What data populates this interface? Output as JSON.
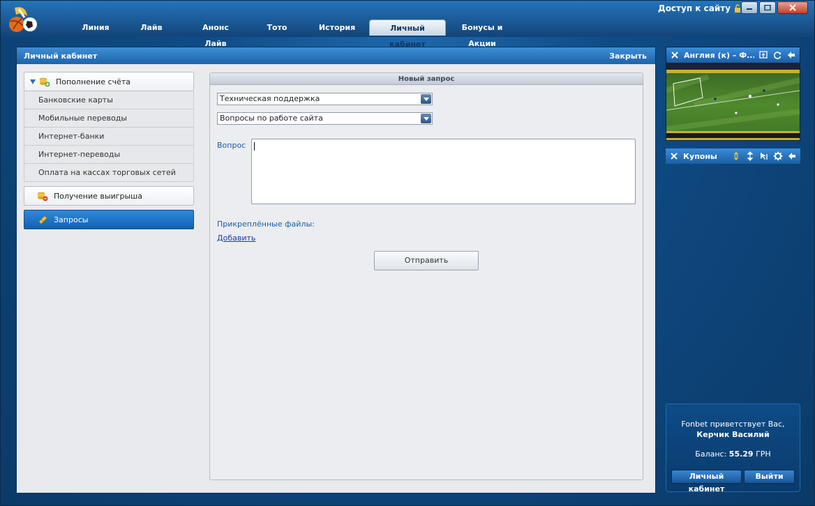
{
  "nav": {
    "tabs": [
      "Линия",
      "Лайв",
      "Анонс Лайв",
      "Тото",
      "История",
      "Личный кабинет",
      "Бонусы и Акции"
    ],
    "active_index": 5,
    "access_label": "Доступ к сайту"
  },
  "main": {
    "title": "Личный кабинет",
    "close_label": "Закрыть"
  },
  "sidebar": {
    "deposit": {
      "label": "Пополнение счёта",
      "items": [
        "Банковские карты",
        "Мобильные переводы",
        "Интернет-банки",
        "Интернет-переводы",
        "Оплата на кассах торговых сетей"
      ]
    },
    "withdraw_label": "Получение выигрыша",
    "requests_label": "Запросы"
  },
  "form": {
    "title": "Новый запрос",
    "select1": "Техническая поддержка",
    "select2": "Вопросы по работе сайта",
    "question_label": "Вопрос",
    "question_value": "",
    "files_label": "Прикреплённые файлы:",
    "add_link": "Добавить",
    "submit_label": "Отправить"
  },
  "video": {
    "title": "Англия (к) – Ф..."
  },
  "coupons": {
    "label": "Купоны"
  },
  "greeting": {
    "line1": "Fonbet приветствует Вас,",
    "user": "Керчик Василий",
    "balance_label": "Баланс:",
    "balance_value": "55.29",
    "currency": "ГРН",
    "cabinet_button": "Личный кабинет",
    "logout_button": "Выйти"
  },
  "colors": {
    "accent": "#1d63a8",
    "active_item": "#1f74c8",
    "link": "#1a5ea5"
  }
}
